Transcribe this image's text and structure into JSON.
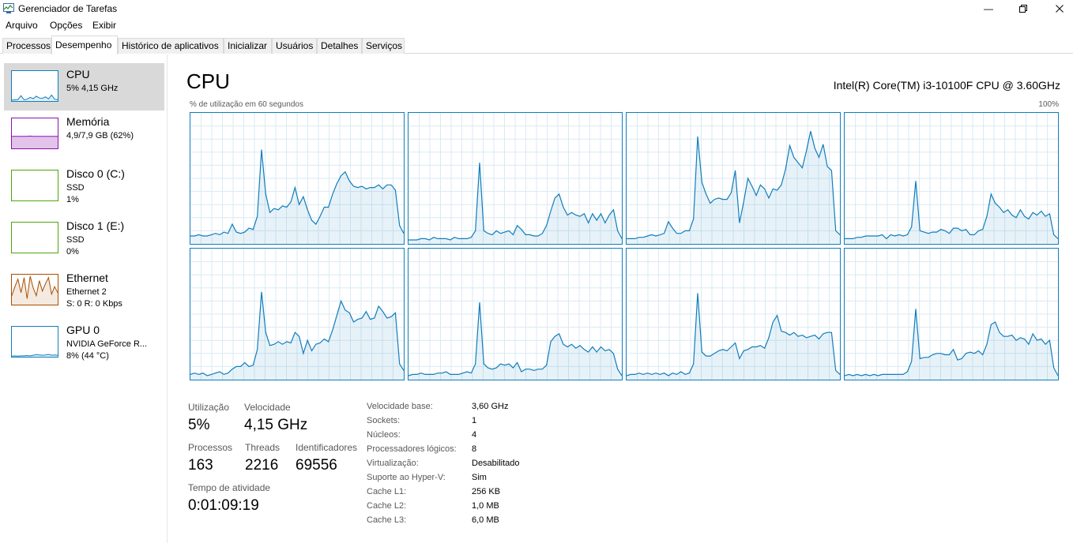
{
  "window": {
    "title": "Gerenciador de Tarefas"
  },
  "menu": [
    "Arquivo",
    "Opções",
    "Exibir"
  ],
  "tabs": [
    "Processos",
    "Desempenho",
    "Histórico de aplicativos",
    "Inicializar",
    "Usuários",
    "Detalhes",
    "Serviços"
  ],
  "active_tab": "Desempenho",
  "sidebar": [
    {
      "name": "CPU",
      "lines": [
        "5%  4,15 GHz"
      ],
      "color": "#117dbb",
      "selected": true
    },
    {
      "name": "Memória",
      "lines": [
        "4,9/7,9 GB (62%)"
      ],
      "color": "#8b12ae",
      "selected": false
    },
    {
      "name": "Disco 0 (C:)",
      "lines": [
        "SSD",
        "1%"
      ],
      "color": "#4da60c",
      "selected": false
    },
    {
      "name": "Disco 1 (E:)",
      "lines": [
        "SSD",
        "0%"
      ],
      "color": "#4da60c",
      "selected": false
    },
    {
      "name": "Ethernet",
      "lines": [
        "Ethernet 2",
        "S: 0  R: 0 Kbps"
      ],
      "color": "#a74f01",
      "selected": false
    },
    {
      "name": "GPU 0",
      "lines": [
        "NVIDIA GeForce R...",
        "8%  (44 °C)"
      ],
      "color": "#117dbb",
      "selected": false
    }
  ],
  "main": {
    "title": "CPU",
    "cpu_model": "Intel(R) Core(TM) i3-10100F CPU @ 3.60GHz",
    "utilization_caption": "% de utilização em 60 segundos",
    "utilization_max": "100%"
  },
  "core_graph_color": "#117dbb",
  "stats": {
    "utilization_label": "Utilização",
    "utilization_value": "5%",
    "speed_label": "Velocidade",
    "speed_value": "4,15 GHz",
    "processes_label": "Processos",
    "processes_value": "163",
    "threads_label": "Threads",
    "threads_value": "2216",
    "handles_label": "Identificadores",
    "handles_value": "69556",
    "uptime_label": "Tempo de atividade",
    "uptime_value": "0:01:09:19"
  },
  "specs": [
    {
      "label": "Velocidade base:",
      "value": "3,60 GHz"
    },
    {
      "label": "Sockets:",
      "value": "1"
    },
    {
      "label": "Núcleos:",
      "value": "4"
    },
    {
      "label": "Processadores lógicos:",
      "value": "8"
    },
    {
      "label": "Virtualização:",
      "value": "Desabilitado"
    },
    {
      "label": "Suporte ao Hyper-V:",
      "value": "Sim"
    },
    {
      "label": "Cache L1:",
      "value": "256 KB"
    },
    {
      "label": "Cache L2:",
      "value": "1,0 MB"
    },
    {
      "label": "Cache L3:",
      "value": "6,0 MB"
    }
  ],
  "core_graphs": [
    [
      6,
      6,
      7,
      6,
      6,
      7,
      8,
      7,
      9,
      8,
      15,
      9,
      8,
      9,
      12,
      11,
      21,
      72,
      38,
      24,
      27,
      26,
      29,
      28,
      32,
      43,
      30,
      36,
      26,
      18,
      15,
      21,
      28,
      28,
      38,
      46,
      52,
      55,
      48,
      44,
      43,
      44,
      42,
      43,
      43,
      45,
      42,
      45,
      45,
      41,
      14,
      8
    ],
    [
      3,
      3,
      3,
      4,
      4,
      3,
      5,
      4,
      4,
      4,
      3,
      5,
      4,
      4,
      4,
      5,
      10,
      62,
      10,
      8,
      7,
      10,
      8,
      9,
      10,
      7,
      14,
      11,
      7,
      7,
      6,
      6,
      8,
      14,
      25,
      35,
      38,
      28,
      22,
      24,
      22,
      21,
      23,
      16,
      23,
      18,
      23,
      16,
      22,
      26,
      10,
      4
    ],
    [
      4,
      4,
      4,
      5,
      5,
      6,
      7,
      6,
      7,
      8,
      17,
      12,
      8,
      8,
      10,
      10,
      19,
      82,
      47,
      38,
      31,
      34,
      35,
      34,
      34,
      39,
      56,
      16,
      32,
      50,
      44,
      37,
      45,
      42,
      35,
      42,
      41,
      45,
      57,
      75,
      66,
      62,
      58,
      71,
      86,
      73,
      66,
      76,
      59,
      56,
      10,
      7
    ],
    [
      4,
      4,
      4,
      5,
      5,
      6,
      6,
      6,
      6,
      7,
      4,
      7,
      6,
      7,
      6,
      7,
      13,
      48,
      10,
      9,
      8,
      9,
      9,
      11,
      10,
      8,
      12,
      12,
      10,
      11,
      7,
      7,
      10,
      11,
      21,
      38,
      31,
      28,
      24,
      26,
      22,
      20,
      26,
      21,
      19,
      24,
      22,
      25,
      21,
      23,
      7,
      4
    ],
    [
      4,
      5,
      4,
      5,
      3,
      4,
      5,
      6,
      4,
      5,
      8,
      10,
      10,
      13,
      10,
      11,
      23,
      67,
      36,
      26,
      27,
      29,
      27,
      29,
      28,
      36,
      33,
      20,
      30,
      22,
      27,
      28,
      31,
      29,
      38,
      49,
      60,
      53,
      51,
      44,
      46,
      47,
      52,
      46,
      47,
      56,
      52,
      47,
      48,
      51,
      12,
      7
    ],
    [
      3,
      4,
      4,
      5,
      4,
      4,
      4,
      5,
      5,
      6,
      4,
      4,
      4,
      5,
      6,
      5,
      12,
      59,
      12,
      9,
      8,
      9,
      12,
      11,
      12,
      9,
      13,
      6,
      8,
      8,
      7,
      8,
      8,
      11,
      29,
      33,
      35,
      27,
      25,
      27,
      24,
      26,
      23,
      21,
      25,
      21,
      25,
      22,
      23,
      20,
      8,
      3
    ],
    [
      3,
      4,
      4,
      5,
      4,
      5,
      4,
      5,
      4,
      5,
      3,
      5,
      4,
      6,
      4,
      5,
      12,
      66,
      21,
      18,
      18,
      20,
      22,
      23,
      22,
      25,
      28,
      16,
      22,
      23,
      25,
      25,
      26,
      24,
      32,
      44,
      49,
      37,
      36,
      34,
      36,
      33,
      34,
      32,
      33,
      34,
      31,
      35,
      36,
      36,
      7,
      4
    ],
    [
      3,
      4,
      3,
      4,
      3,
      4,
      3,
      4,
      3,
      4,
      4,
      4,
      4,
      4,
      4,
      6,
      14,
      54,
      16,
      17,
      17,
      19,
      20,
      20,
      19,
      19,
      23,
      15,
      16,
      20,
      21,
      20,
      22,
      19,
      27,
      42,
      44,
      36,
      33,
      33,
      34,
      30,
      32,
      31,
      27,
      35,
      30,
      31,
      27,
      30,
      9,
      3
    ]
  ]
}
